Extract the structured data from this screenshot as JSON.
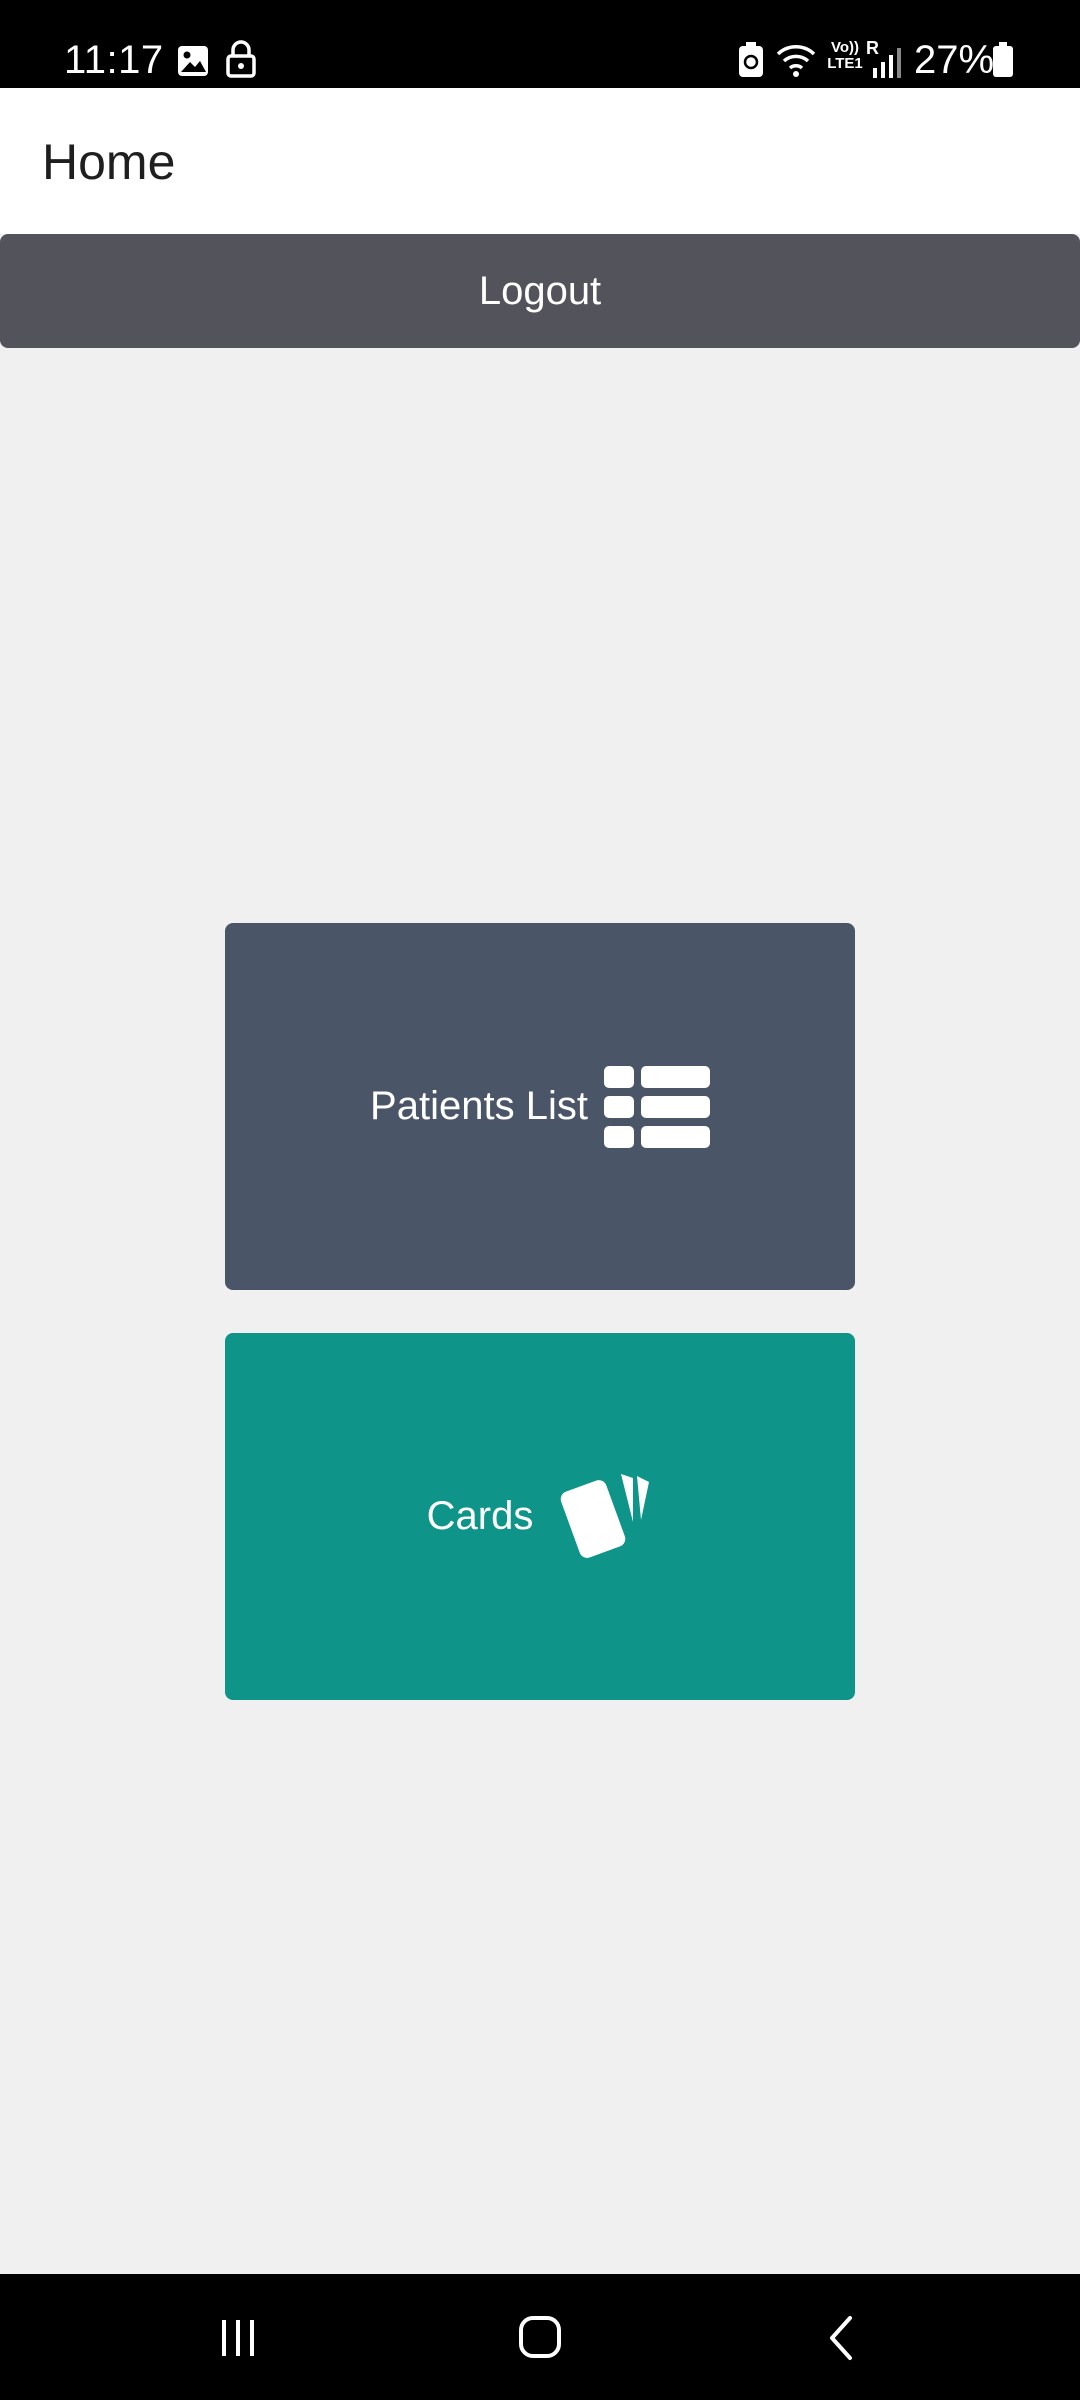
{
  "status_bar": {
    "time": "11:17",
    "network_label": "Vo)) LTE1",
    "roaming_label": "R",
    "battery_percent": "27%"
  },
  "app_bar": {
    "title": "Home"
  },
  "logout": {
    "label": "Logout"
  },
  "tiles": [
    {
      "label": "Patients List",
      "icon": "list-icon",
      "color": "#4a5568"
    },
    {
      "label": "Cards",
      "icon": "cards-icon",
      "color": "#0e9488"
    }
  ],
  "colors": {
    "logout_bg": "#53535c",
    "background": "#f0f0f0"
  }
}
